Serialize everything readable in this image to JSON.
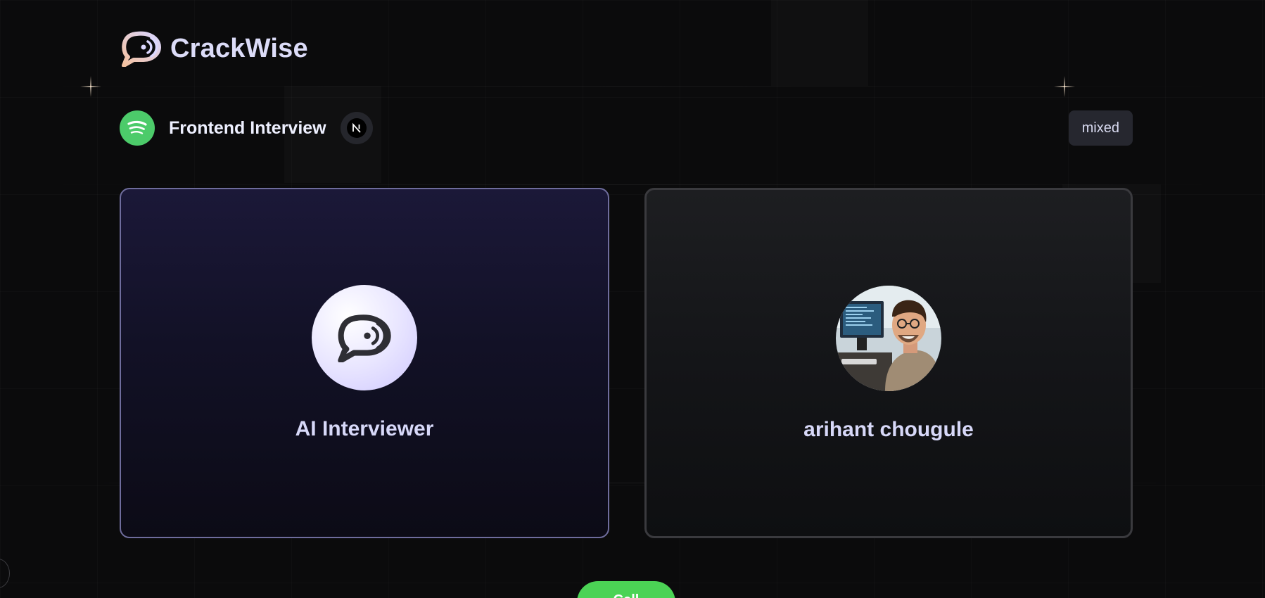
{
  "brand": {
    "name": "CrackWise",
    "logo_icon": "chat-voice-icon"
  },
  "interview": {
    "title": "Frontend Interview",
    "company_icon": "spotify-icon",
    "tech_icon": "nextjs-icon",
    "type": "mixed"
  },
  "cards": {
    "ai": {
      "name": "AI Interviewer",
      "icon": "chat-voice-icon"
    },
    "user": {
      "name": "arihant chougule",
      "avatar": "user-avatar-photo"
    }
  },
  "actions": {
    "call_label": "Call"
  },
  "colors": {
    "accent_green": "#4bd355",
    "ai_card_border": "#6e6c9c",
    "background": "#0b0b0c"
  }
}
